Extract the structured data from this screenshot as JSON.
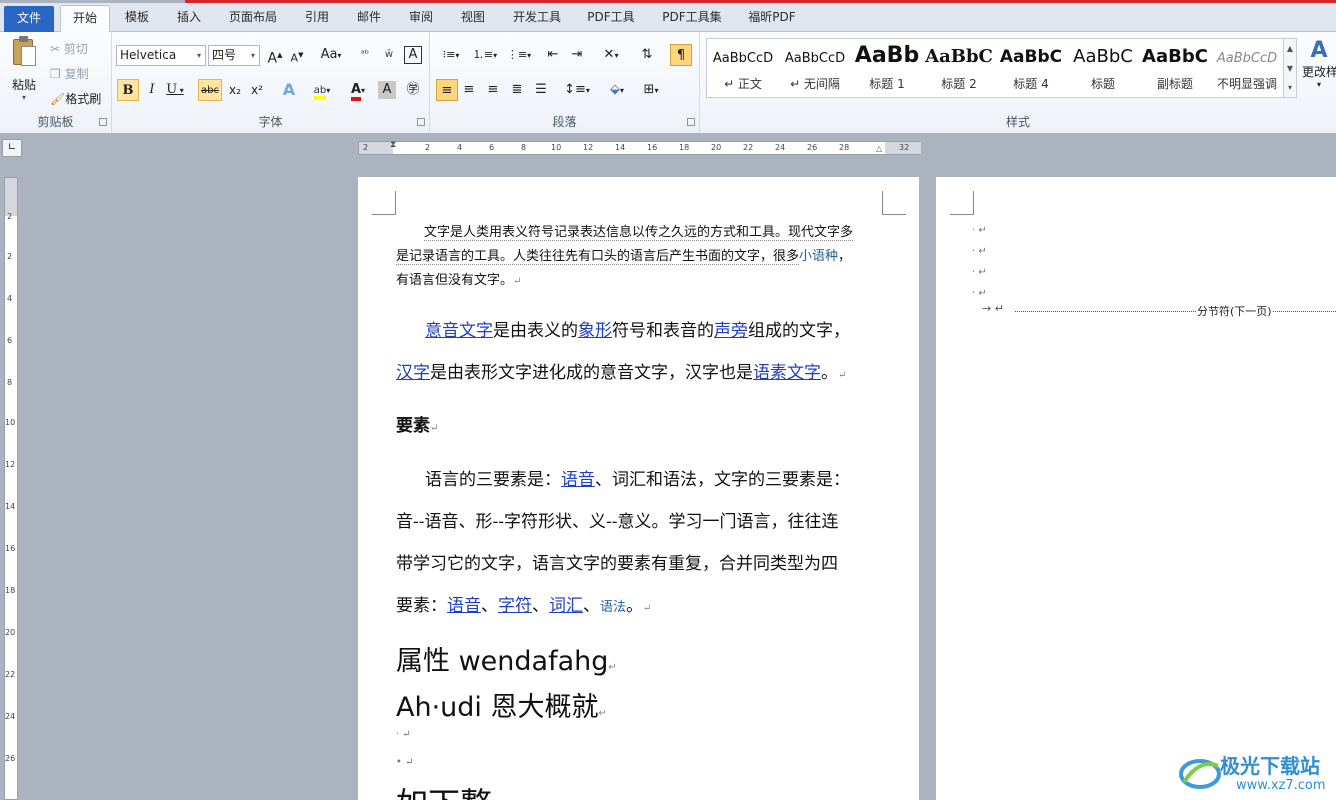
{
  "tabs": [
    "文件",
    "开始",
    "模板",
    "插入",
    "页面布局",
    "引用",
    "邮件",
    "审阅",
    "视图",
    "开发工具",
    "PDF工具",
    "PDF工具集",
    "福昕PDF"
  ],
  "clipboard": {
    "paste": "粘贴",
    "cut": "剪切",
    "copy": "复制",
    "format_painter": "格式刷",
    "label": "剪贴板"
  },
  "font": {
    "name": "Helvetica",
    "size": "四号",
    "label": "字体",
    "grow": "A",
    "shrink": "A",
    "change_case": "Aa",
    "bold": "B",
    "italic": "I",
    "underline": "U",
    "strike": "abc",
    "sub": "x₂",
    "sup": "x²"
  },
  "paragraph": {
    "label": "段落"
  },
  "styles": {
    "label": "样式",
    "change": "更改样",
    "items": [
      {
        "preview": "AaBbCcD",
        "name": "↵ 正文"
      },
      {
        "preview": "AaBbCcD",
        "name": "↵ 无间隔"
      },
      {
        "preview": "AaBb",
        "name": "标题 1"
      },
      {
        "preview": "AaBbC",
        "name": "标题 2"
      },
      {
        "preview": "AaBbC",
        "name": "标题 4"
      },
      {
        "preview": "AaBbC",
        "name": "标题"
      },
      {
        "preview": "AaBbC",
        "name": "副标题"
      },
      {
        "preview": "AaBbCcD",
        "name": "不明显强调"
      }
    ]
  },
  "ruler_top": [
    "2",
    "2",
    "4",
    "6",
    "8",
    "10",
    "12",
    "14",
    "16",
    "18",
    "20",
    "22",
    "24",
    "26",
    "28",
    "32"
  ],
  "ruler_left": [
    "2",
    "2",
    "4",
    "6",
    "8",
    "10",
    "12",
    "14",
    "16",
    "18",
    "20",
    "22",
    "24",
    "26"
  ],
  "doc": {
    "p1a": "文字是人类用表义符号记录表达信息以传之久远的方式和工具。现代文字多",
    "p1b": "是记录语言的工具。人类往往先有口头的语言后产生书面的文字，很多",
    "p1b_link": "小语种",
    "p1b_end": "，",
    "p1c": "有语言但没有文字。",
    "p2_l1": "意音文字",
    "p2_t1": "是由表义的",
    "p2_l2": "象形",
    "p2_t2": "符号和表音的",
    "p2_l3": "声旁",
    "p2_t3": "组成的文字，",
    "p2_l4": "汉字",
    "p2_t4": "是由表形文字进化成的意音文字，汉字也是",
    "p2_l5": "语素文字",
    "p2_t5": "。",
    "heading": "要素",
    "p3_t1": "语言的三要素是：",
    "p3_l1": "语音",
    "p3_t2": "、词汇和语法，文字的三要素是：",
    "p3_line2": "音--语音、形--字符形状、义--意义。学习一门语言，往往连",
    "p3_line3": "带学习它的文字，语言文字的要素有重复，合并同类型为四",
    "p3_t4": "要素：",
    "p3_l2": "语音",
    "p3_sep1": "、",
    "p3_l3": "字符",
    "p3_sep2": "、",
    "p3_l4": "词汇",
    "p3_sep3": "、",
    "p3_l5": "语法",
    "p3_end": "。",
    "big1": "属性 wendafahg",
    "big2": "Ah·udi 恩大概就",
    "big3": "如下整",
    "section_break": "分节符(下一页)"
  },
  "watermark": {
    "brand": "极光下载站",
    "url": "www.xz7.com"
  }
}
